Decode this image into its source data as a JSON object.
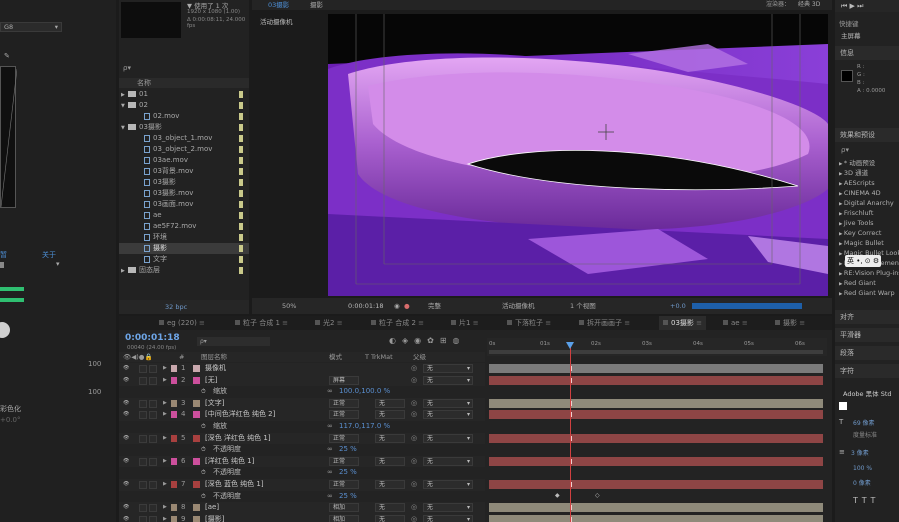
{
  "left_panel": {
    "top_text": "G8",
    "link_a": "暂",
    "link_b": "关于",
    "values": [
      "100",
      "100"
    ],
    "label_bottom": "彩色化",
    "label_value": "+0.0°"
  },
  "project": {
    "footage_info": [
      "▼ 使用了 1 次",
      "1920 x 1080 (1.00)",
      "Δ 0:00:08:11, 24.000 fps"
    ],
    "search_placeholder": "ρ▾",
    "col_name": "名称",
    "items": [
      {
        "label": "01",
        "type": "folder",
        "indent": 0,
        "twirl": "▶"
      },
      {
        "label": "02",
        "type": "folder",
        "indent": 0,
        "twirl": "▼"
      },
      {
        "label": "02.mov",
        "type": "file",
        "indent": 2,
        "twirl": ""
      },
      {
        "label": "03摄影",
        "type": "folder",
        "indent": 0,
        "twirl": "▼"
      },
      {
        "label": "03_object_1.mov",
        "type": "file",
        "indent": 2,
        "twirl": ""
      },
      {
        "label": "03_object_2.mov",
        "type": "file",
        "indent": 2,
        "twirl": ""
      },
      {
        "label": "03ae.mov",
        "type": "file",
        "indent": 2,
        "twirl": ""
      },
      {
        "label": "03背景.mov",
        "type": "file",
        "indent": 2,
        "twirl": ""
      },
      {
        "label": "03摄影",
        "type": "file",
        "indent": 2,
        "twirl": ""
      },
      {
        "label": "03摄影.mov",
        "type": "file",
        "indent": 2,
        "twirl": ""
      },
      {
        "label": "03画面.mov",
        "type": "file",
        "indent": 2,
        "twirl": ""
      },
      {
        "label": "ae",
        "type": "file",
        "indent": 2,
        "twirl": ""
      },
      {
        "label": "ae5F72.mov",
        "type": "file",
        "indent": 2,
        "twirl": ""
      },
      {
        "label": "环境",
        "type": "file",
        "indent": 2,
        "twirl": ""
      },
      {
        "label": "摄影",
        "type": "file",
        "indent": 2,
        "twirl": "",
        "selected": true
      },
      {
        "label": "文字",
        "type": "file",
        "indent": 2,
        "twirl": ""
      },
      {
        "label": "固态层",
        "type": "folder",
        "indent": 0,
        "twirl": "▶"
      }
    ],
    "bpc": "32 bpc"
  },
  "viewer": {
    "tab_label": "03摄影",
    "comp_name": "摄影",
    "camera_label": "活动摄像机",
    "renderer_label": "渲染器：",
    "renderer_value": "经典 3D",
    "zoom": "50%",
    "timecode": "0:00:01:18",
    "quality": "完整",
    "view_camera": "活动摄像机",
    "view_count": "1 个视图",
    "exposure": "+0.0"
  },
  "tabs": [
    {
      "label": "eg (220)"
    },
    {
      "label": "粒子 合成 1"
    },
    {
      "label": "光2"
    },
    {
      "label": "粒子 合成 2"
    },
    {
      "label": "片1"
    },
    {
      "label": "下落粒子"
    },
    {
      "label": "拆开画画子"
    },
    {
      "label": "03摄影",
      "active": true
    },
    {
      "label": "ae"
    },
    {
      "label": "摄影"
    }
  ],
  "timeline": {
    "timecode": "0:00:01:18",
    "frames": "00040 (24.00 fps)",
    "search_placeholder": "ρ▾",
    "col_layer": "图层名称",
    "col_mode": "模式",
    "col_trk": "T TrkMat",
    "col_parent": "父级",
    "ruler": [
      "0s",
      "01s",
      "02s",
      "03s",
      "04s",
      "05s",
      "06s"
    ],
    "layers": [
      {
        "kind": "layer",
        "num": "1",
        "name": "摄像机",
        "color": "#c9a8ad",
        "mode": "",
        "trk": "",
        "parent": "无",
        "bar": "#7b7b7b"
      },
      {
        "kind": "layer",
        "num": "2",
        "name": "[无]",
        "color": "#cc4f9c",
        "mode": "屏幕",
        "trk": "",
        "parent": "无",
        "bar": "#8e4545"
      },
      {
        "kind": "prop",
        "name": "缩放",
        "value": "100.0,100.0 %"
      },
      {
        "kind": "layer",
        "num": "3",
        "name": "[文字]",
        "color": "#9a8873",
        "mode": "正常",
        "trk": "无",
        "parent": "无",
        "bar": "#8f8a7a"
      },
      {
        "kind": "layer",
        "num": "4",
        "name": "[中间色洋红色 纯色 2]",
        "color": "#cc4f9c",
        "mode": "正常",
        "trk": "无",
        "parent": "无",
        "bar": "#8e4545"
      },
      {
        "kind": "prop",
        "name": "缩放",
        "value": "117.0,117.0 %"
      },
      {
        "kind": "layer",
        "num": "5",
        "name": "[深色 洋红色 纯色 1]",
        "color": "#a8403f",
        "mode": "正常",
        "trk": "无",
        "parent": "无",
        "bar": "#8e4545"
      },
      {
        "kind": "prop",
        "name": "不透明度",
        "value": "25 %"
      },
      {
        "kind": "layer",
        "num": "6",
        "name": "[洋红色 纯色 1]",
        "color": "#cc4f9c",
        "mode": "正常",
        "trk": "无",
        "parent": "无",
        "bar": "#8e4545"
      },
      {
        "kind": "prop",
        "name": "不透明度",
        "value": "25 %"
      },
      {
        "kind": "layer",
        "num": "7",
        "name": "[深色 蓝色 纯色 1]",
        "color": "#a8403f",
        "mode": "正常",
        "trk": "无",
        "parent": "无",
        "bar": "#8e4545"
      },
      {
        "kind": "prop",
        "name": "不透明度",
        "value": "25 %"
      },
      {
        "kind": "layer",
        "num": "8",
        "name": "[ae]",
        "color": "#9a8873",
        "mode": "相加",
        "trk": "无",
        "parent": "无",
        "bar": "#8f8a7a"
      },
      {
        "kind": "layer",
        "num": "9",
        "name": "[摄影]",
        "color": "#9a8873",
        "mode": "相加",
        "trk": "无",
        "parent": "无",
        "bar": "#8f8a7a"
      }
    ]
  },
  "right_panel": {
    "view_label": "快捷键",
    "view_value": "主屏幕",
    "info_label": "信息",
    "info_lines": [
      "R :",
      "G :",
      "B :",
      "A : 0.0000"
    ],
    "effects_label": "效果和预设",
    "search_placeholder": "ρ▾",
    "effects": [
      "* 动画预设",
      "3D 通道",
      "AEScripts",
      "CINEMA 4D",
      "Digital Anarchy",
      "Frischluft",
      "Jive Tools",
      "Key Correct",
      "Magic Bullet",
      "Magic Bullet Looks",
      "NewBlue Elements",
      "RE:Vision Plug-ins",
      "Red Giant",
      "Red Giant Warp"
    ],
    "align_label": "对齐",
    "smoother_label": "平滑器",
    "paragraph_label": "段落",
    "char_label": "字符",
    "font_name": "Adobe 黑体 Std",
    "font_size": "69 像素",
    "leading": "度量标准",
    "stroke": "3 像素",
    "scale": "100 %",
    "baseline": "0 像素",
    "ime_badge": "英 •, ⊙ ⚙"
  }
}
